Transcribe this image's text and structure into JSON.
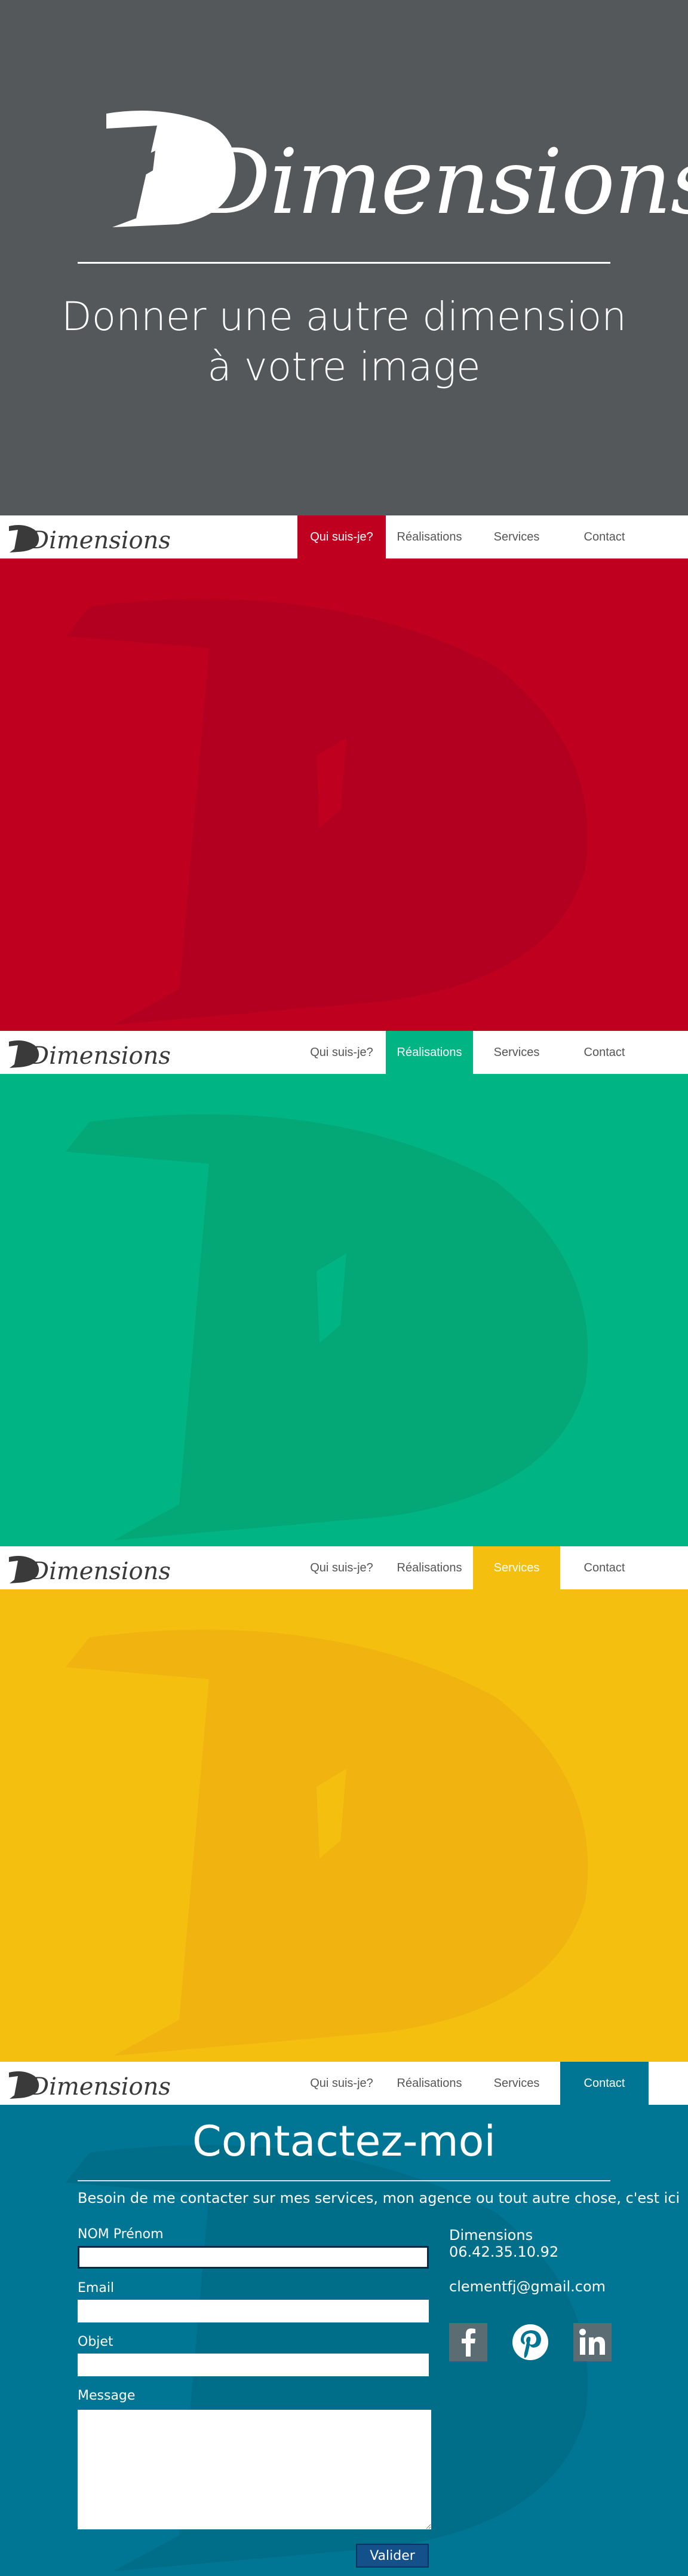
{
  "brand": {
    "name": "Dimensions",
    "tagline_line1": "Donner une autre dimension",
    "tagline_line2": "à votre image"
  },
  "nav": {
    "items": [
      "Qui suis-je?",
      "Réalisations",
      "Services",
      "Contact"
    ]
  },
  "colors": {
    "hero_bg": "#55585a",
    "qui": "#c0001f",
    "realisations": "#00b583",
    "services": "#f5bf10",
    "contact": "#007694"
  },
  "contact": {
    "title": "Contactez-moi",
    "intro": "Besoin de me contacter sur mes services, mon agence ou tout autre chose, c'est ici",
    "labels": {
      "name": "NOM Prénom",
      "email": "Email",
      "subject": "Objet",
      "message": "Message"
    },
    "submit": "Valider",
    "info": {
      "company": "Dimensions",
      "phone": "06.42.35.10.92",
      "email": "clementfj@gmail.com"
    },
    "social_icons": [
      "facebook-icon",
      "pinterest-icon",
      "linkedin-icon"
    ]
  }
}
